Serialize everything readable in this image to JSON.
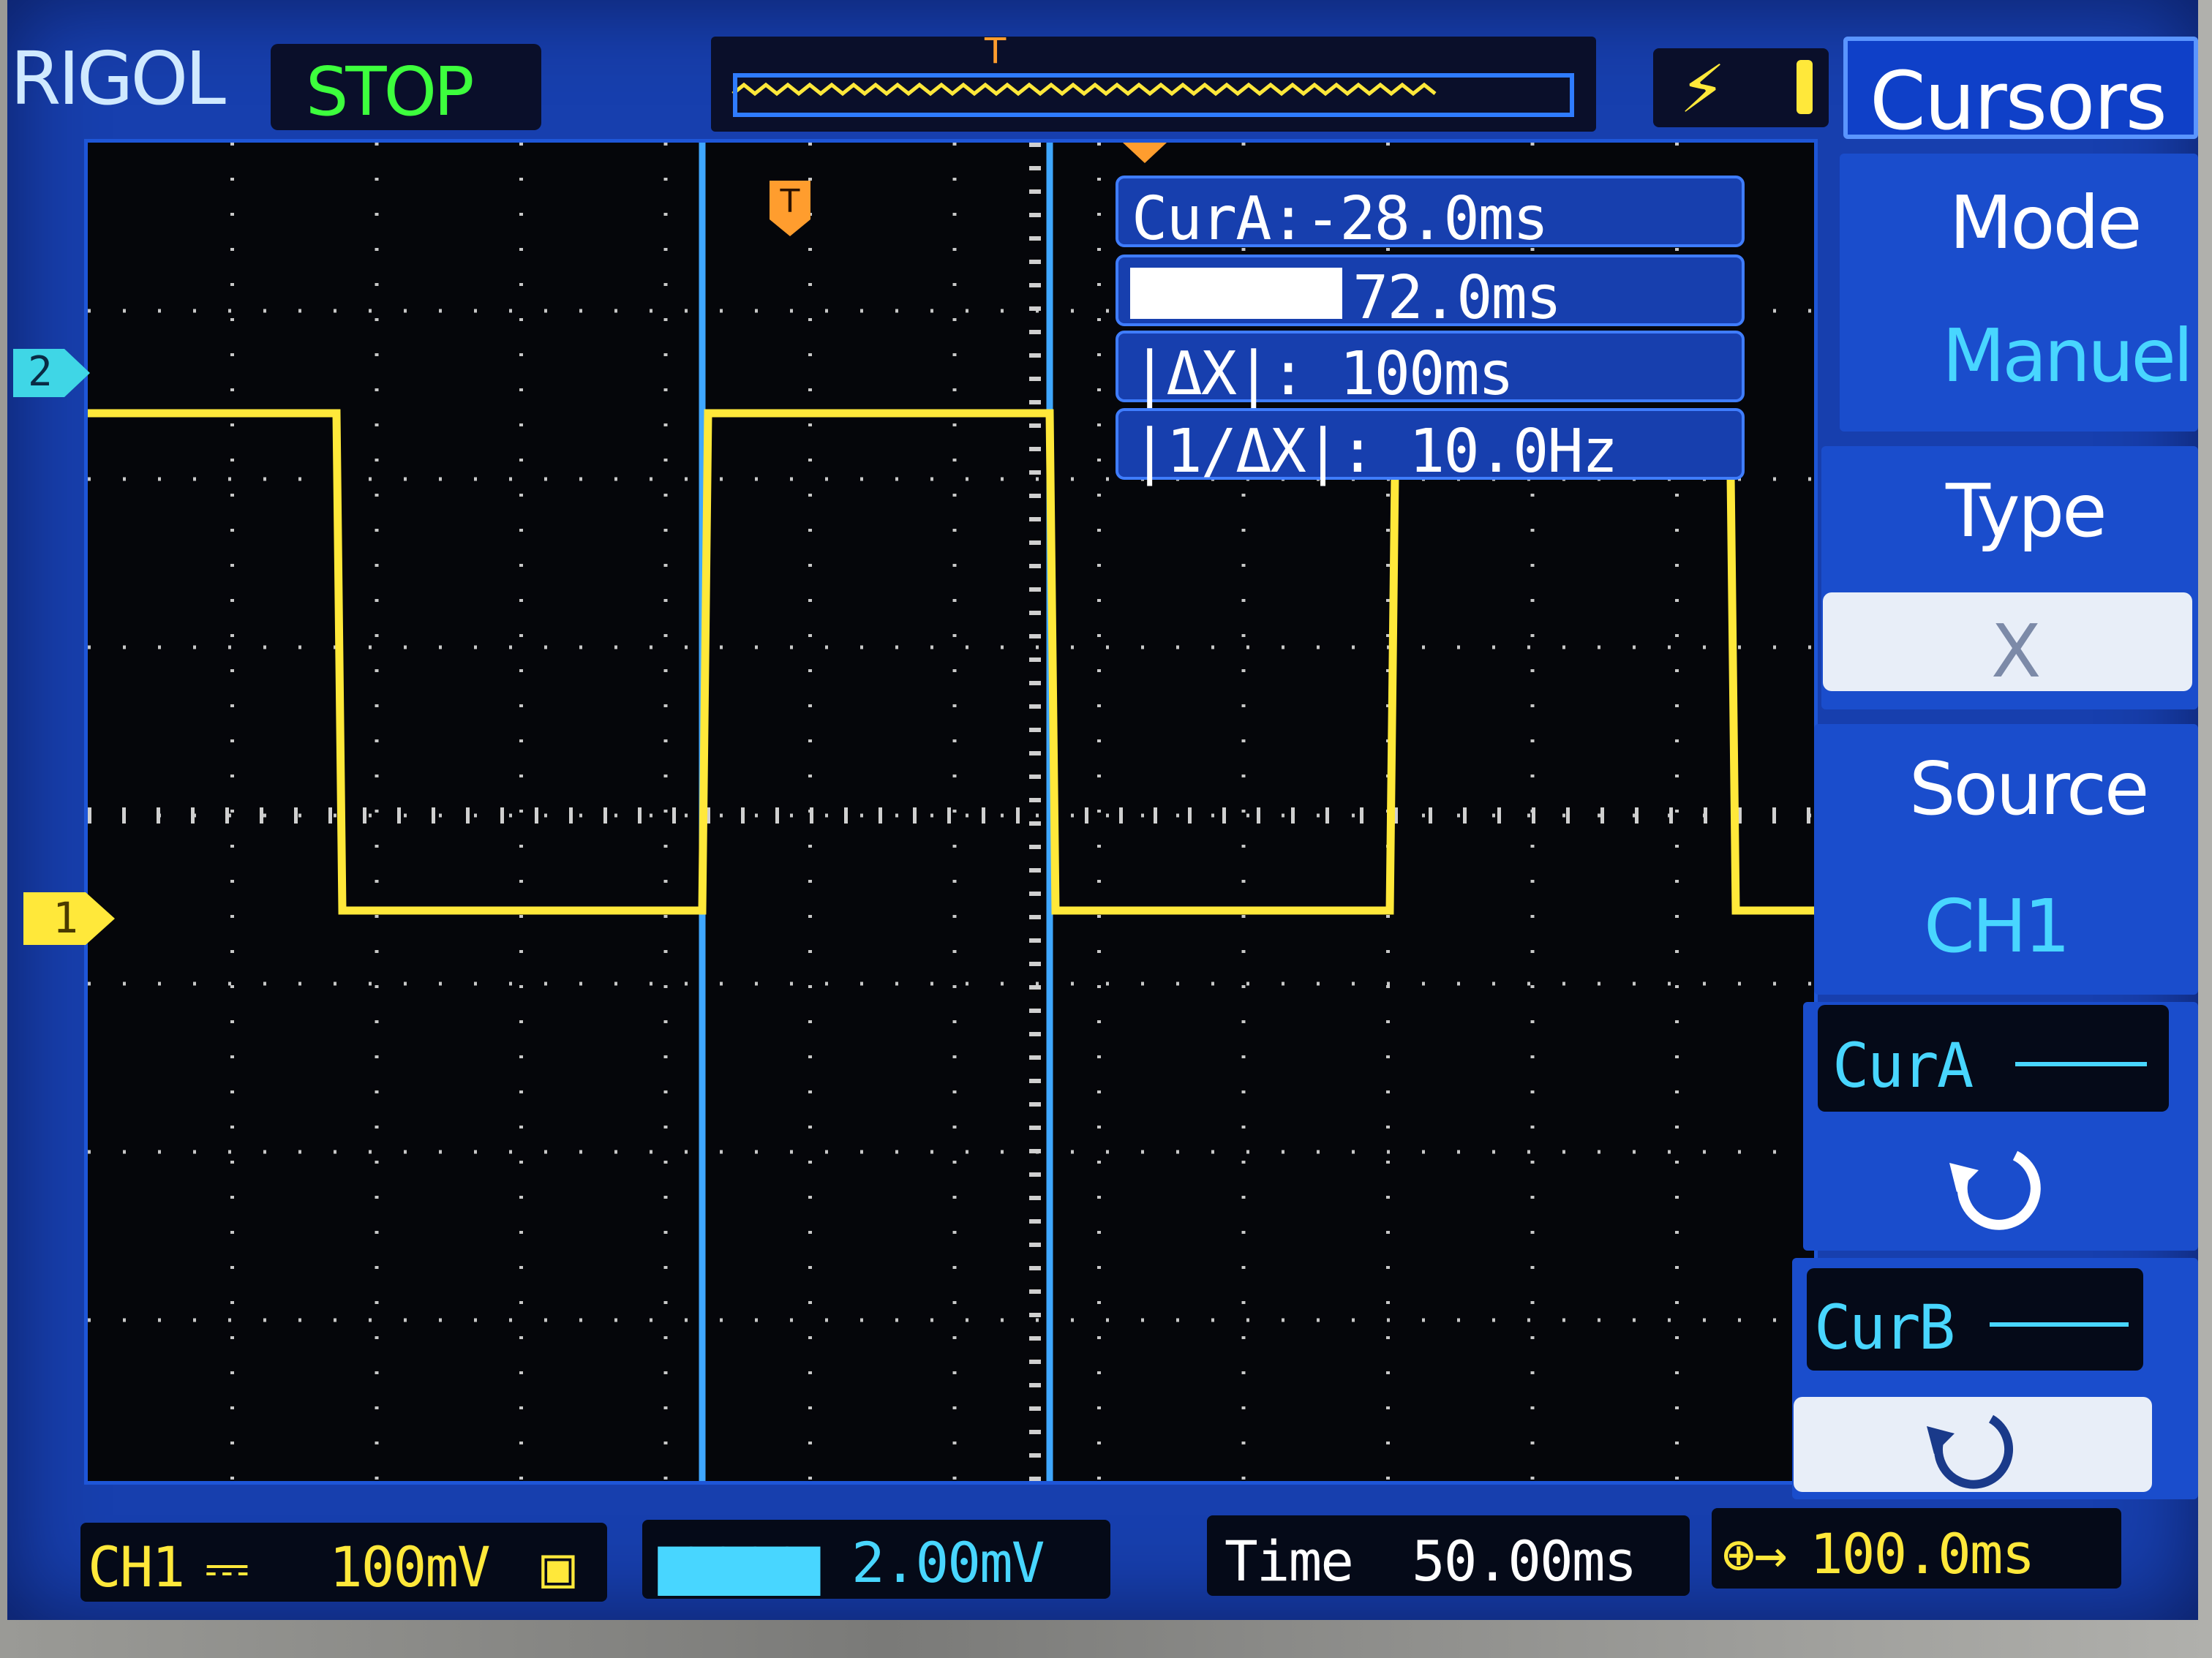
{
  "header": {
    "brand": "RIGOL",
    "run_state": "STOP",
    "trigger_marker": "T"
  },
  "menu": {
    "title": "Cursors",
    "mode_label": "Mode",
    "mode_value": "Manuel",
    "type_label": "Type",
    "type_value": "X",
    "source_label": "Source",
    "source_value": "CH1",
    "cur_a_label": "CurA",
    "cur_b_label": "CurB"
  },
  "readout": {
    "cur_a": "CurA:-28.0ms",
    "cur_b_value": "72.0ms",
    "delta_x": "|ΔX|: 100ms",
    "inv_delta_x": "|1/ΔX|: 10.0Hz"
  },
  "channels": {
    "ch2_marker": "2",
    "ch1_marker": "1"
  },
  "status_bar": {
    "ch1_label": "CH1",
    "ch1_scale": "100mV",
    "ch2_scale": "2.00mV",
    "time_label": "Time",
    "time_scale": "50.00ms",
    "trigger_delay": "100.0ms"
  },
  "colors": {
    "screen_bg": "#173fae",
    "trace_ch1": "#ffe83a",
    "cursor": "#3fa7ff",
    "accent_cyan": "#48d6ff"
  },
  "icons": {
    "trigger_edge": "rising-edge-icon",
    "knob_a": "rotate-knob-icon",
    "knob_b": "rotate-knob-icon",
    "ch1_coupling": "dc-coupling-icon",
    "ch1_bandwidth": "bandwidth-limit-icon",
    "trigger_delay": "trigger-delay-icon"
  }
}
